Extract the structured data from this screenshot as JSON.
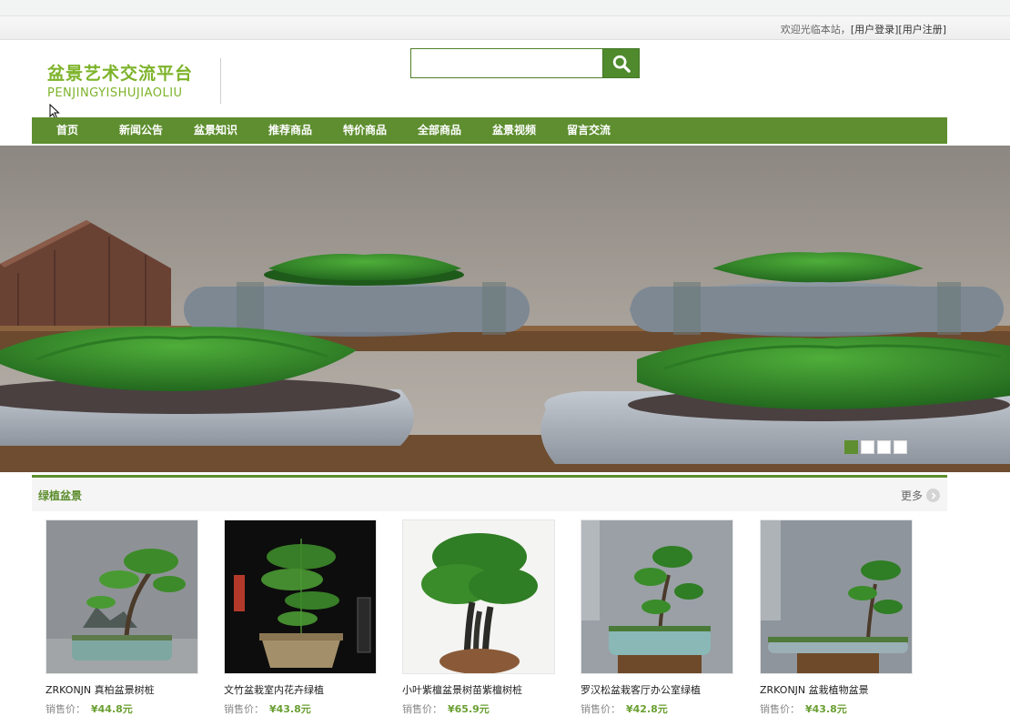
{
  "welcome": {
    "text": "欢迎光临本站，",
    "login": "[用户登录]",
    "register": "[用户注册]"
  },
  "logo": {
    "cn": "盆景艺术交流平台",
    "en": "PENJINGYISHUJIAOLIU"
  },
  "search": {
    "placeholder": "",
    "value": ""
  },
  "nav": {
    "items": [
      {
        "label": "首页"
      },
      {
        "label": "新闻公告"
      },
      {
        "label": "盆景知识"
      },
      {
        "label": "推荐商品"
      },
      {
        "label": "特价商品"
      },
      {
        "label": "全部商品"
      },
      {
        "label": "盆景视频"
      },
      {
        "label": "留言交流"
      }
    ]
  },
  "banner": {
    "slides": 4,
    "active": 1
  },
  "section": {
    "title": "绿植盆景",
    "more": "更多"
  },
  "products": [
    {
      "name": "ZRKONJN 真柏盆景树桩",
      "price_label": "销售价：",
      "price": "¥44.8元"
    },
    {
      "name": "文竹盆栽室内花卉绿植",
      "price_label": "销售价：",
      "price": "¥43.8元"
    },
    {
      "name": "小叶紫檀盆景树苗紫檀树桩",
      "price_label": "销售价：",
      "price": "¥65.9元"
    },
    {
      "name": "罗汉松盆栽客厅办公室绿植",
      "price_label": "销售价：",
      "price": "¥42.8元"
    },
    {
      "name": "ZRKONJN 盆栽植物盆景",
      "price_label": "销售价：",
      "price": "¥43.8元"
    }
  ],
  "colors": {
    "brand_green": "#5e8e2f",
    "logo_green": "#7db32a",
    "price_green": "#6aa032"
  }
}
